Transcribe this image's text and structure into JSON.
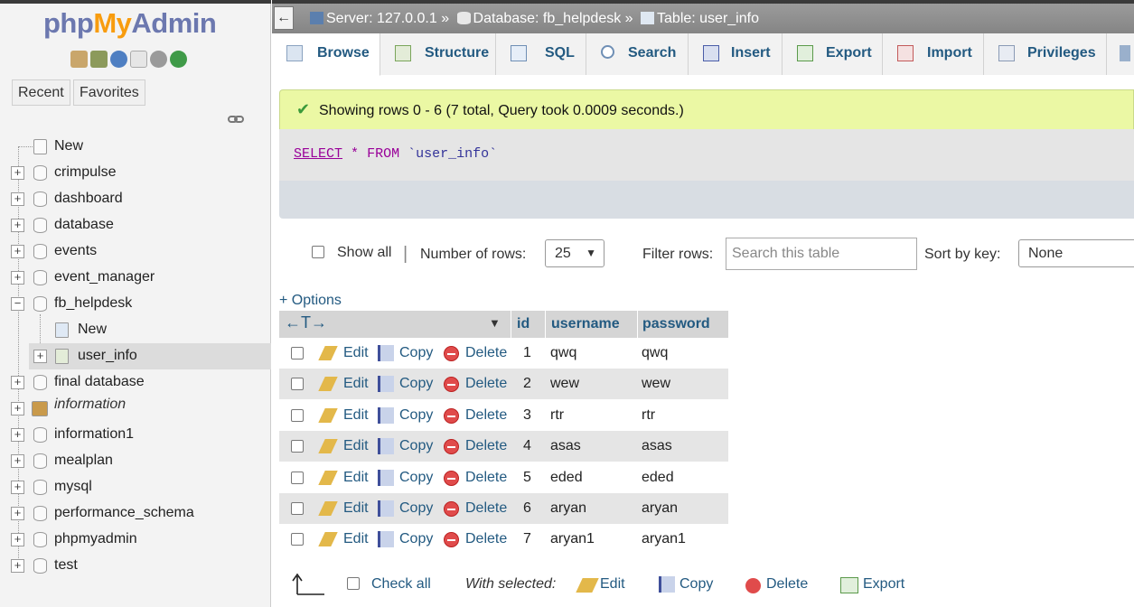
{
  "sidebar": {
    "logo": {
      "php": "php",
      "my": "My",
      "admin": "Admin"
    },
    "nav": {
      "recent": "Recent",
      "favorites": "Favorites"
    },
    "tree": [
      {
        "label": "New",
        "type": "new"
      },
      {
        "label": "crimpulse",
        "type": "db"
      },
      {
        "label": "dashboard",
        "type": "db"
      },
      {
        "label": "database",
        "type": "db"
      },
      {
        "label": "events",
        "type": "db"
      },
      {
        "label": "event_manager",
        "type": "db"
      },
      {
        "label": "fb_helpdesk",
        "type": "db-open"
      },
      {
        "label": "New",
        "type": "sub-new"
      },
      {
        "label": "user_info",
        "type": "sub-table"
      },
      {
        "label": "final database",
        "type": "db"
      },
      {
        "label": "information",
        "type": "db-italic"
      },
      {
        "label": "information1",
        "type": "db"
      },
      {
        "label": "mealplan",
        "type": "db"
      },
      {
        "label": "mysql",
        "type": "db"
      },
      {
        "label": "performance_schema",
        "type": "db"
      },
      {
        "label": "phpmyadmin",
        "type": "db"
      },
      {
        "label": "test",
        "type": "db"
      }
    ]
  },
  "breadcrumb": {
    "back": "←",
    "server": "Server: 127.0.0.1 »",
    "database": "Database: fb_helpdesk »",
    "table": "Table: user_info"
  },
  "tabs": [
    "Browse",
    "Structure",
    "SQL",
    "Search",
    "Insert",
    "Export",
    "Import",
    "Privileges"
  ],
  "result": {
    "message": "Showing rows 0 - 6 (7 total, Query took 0.0009 seconds.)",
    "sql": {
      "select": "SELECT",
      "star": "*",
      "from": "FROM",
      "table": "`user_info`"
    }
  },
  "controls": {
    "show_all": "Show all",
    "separator": "|",
    "rows_label": "Number of rows:",
    "rows_value": "25",
    "filter_label": "Filter rows:",
    "filter_placeholder": "Search this table",
    "sort_label": "Sort by key:",
    "sort_value": "None"
  },
  "options_link": "+ Options",
  "table": {
    "arrows": "←T→",
    "columns": [
      "id",
      "username",
      "password"
    ],
    "actions": {
      "edit": "Edit",
      "copy": "Copy",
      "delete": "Delete"
    },
    "rows": [
      {
        "id": "1",
        "username": "qwq",
        "password": "qwq"
      },
      {
        "id": "2",
        "username": "wew",
        "password": "wew"
      },
      {
        "id": "3",
        "username": "rtr",
        "password": "rtr"
      },
      {
        "id": "4",
        "username": "asas",
        "password": "asas"
      },
      {
        "id": "5",
        "username": "eded",
        "password": "eded"
      },
      {
        "id": "6",
        "username": "aryan",
        "password": "aryan"
      },
      {
        "id": "7",
        "username": "aryan1",
        "password": "aryan1"
      }
    ]
  },
  "bottom": {
    "check_all": "Check all",
    "with_selected": "With selected:",
    "edit": "Edit",
    "copy": "Copy",
    "delete": "Delete",
    "export": "Export"
  }
}
